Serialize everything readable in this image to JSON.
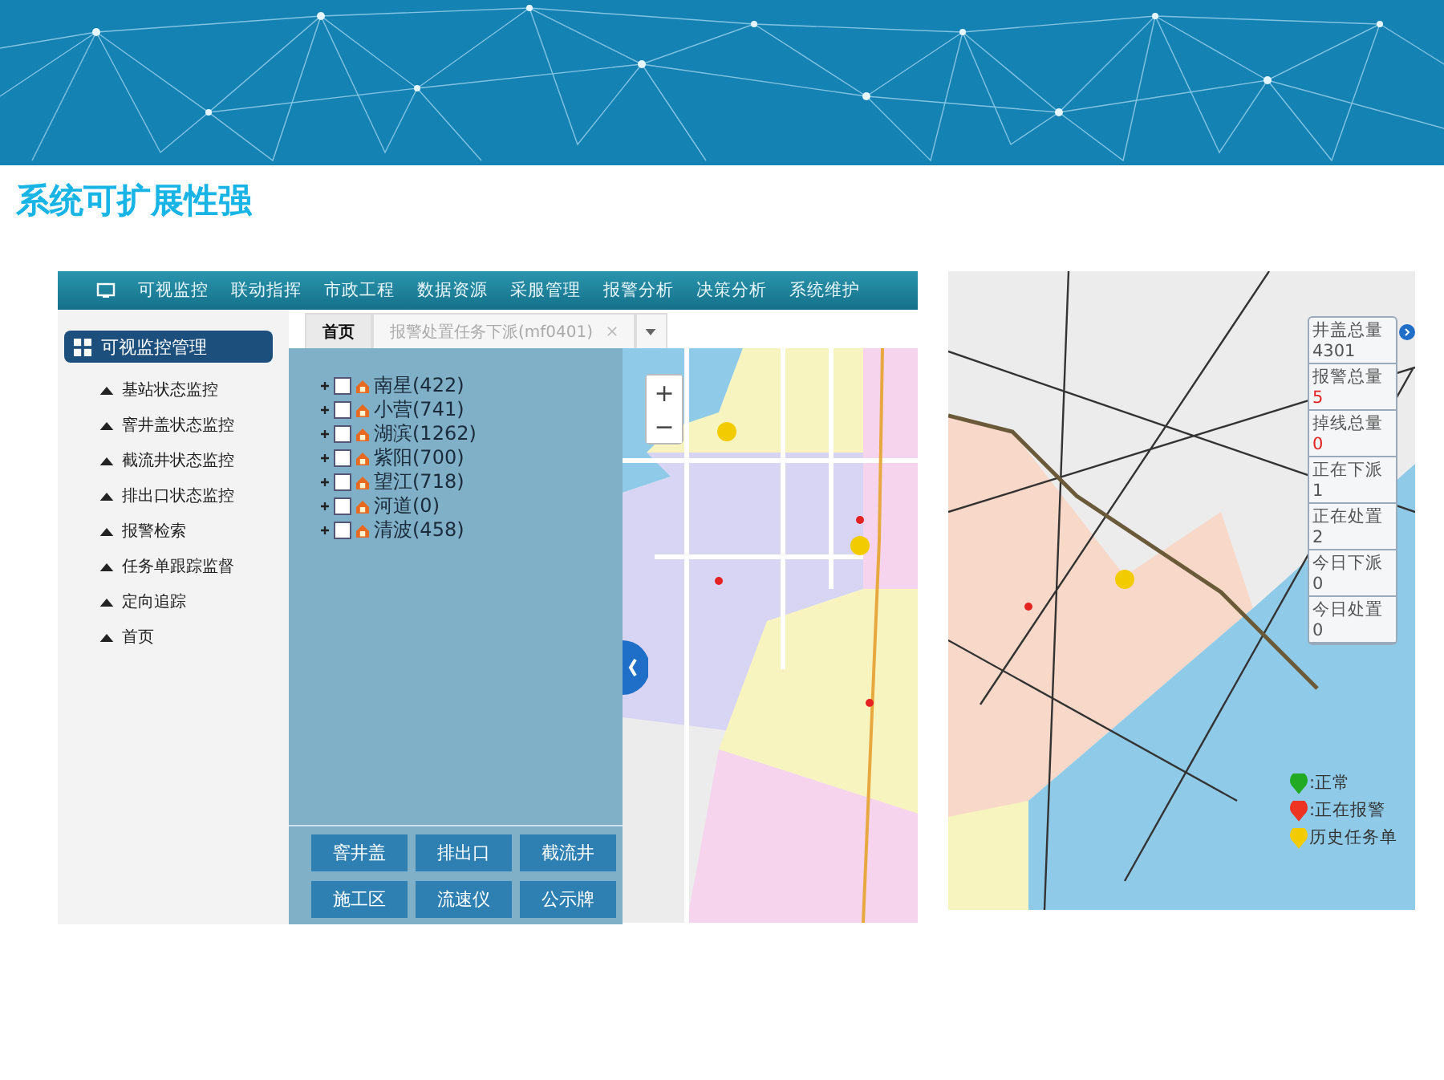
{
  "slide": {
    "title": "系统可扩展性强"
  },
  "left_app": {
    "nav": [
      {
        "label": "可视监控"
      },
      {
        "label": "联动指挥"
      },
      {
        "label": "市政工程"
      },
      {
        "label": "数据资源"
      },
      {
        "label": "采服管理"
      },
      {
        "label": "报警分析"
      },
      {
        "label": "决策分析"
      },
      {
        "label": "系统维护"
      }
    ],
    "sidebar": {
      "header": "可视监控管理",
      "items": [
        {
          "label": "基站状态监控"
        },
        {
          "label": "窨井盖状态监控"
        },
        {
          "label": "截流井状态监控"
        },
        {
          "label": "排出口状态监控"
        },
        {
          "label": "报警检索"
        },
        {
          "label": "任务单跟踪监督"
        },
        {
          "label": "定向追踪"
        },
        {
          "label": "首页"
        }
      ]
    },
    "tabs": [
      {
        "label": "首页",
        "selected": true,
        "closable": false
      },
      {
        "label": "报警处置任务下派(mf0401)",
        "selected": false,
        "closable": true
      }
    ],
    "tree": [
      {
        "label": "南星(422)",
        "checked": false
      },
      {
        "label": "小营(741)",
        "checked": false
      },
      {
        "label": "湖滨(1262)",
        "checked": false
      },
      {
        "label": "紫阳(700)",
        "checked": false
      },
      {
        "label": "望江(718)",
        "checked": false
      },
      {
        "label": "河道(0)",
        "checked": false
      },
      {
        "label": "清波(458)",
        "checked": false
      }
    ],
    "buttons": [
      {
        "label": "窨井盖"
      },
      {
        "label": "排出口"
      },
      {
        "label": "截流井"
      },
      {
        "label": "施工区"
      },
      {
        "label": "流速仪"
      },
      {
        "label": "公示牌"
      }
    ],
    "zoom": {
      "in": "+",
      "out": "−"
    }
  },
  "right_app": {
    "stats": [
      {
        "label": "井盖总量",
        "value": "4301",
        "alert": false
      },
      {
        "label": "报警总量",
        "value": "5",
        "alert": true
      },
      {
        "label": "掉线总量",
        "value": "0",
        "alert": true
      },
      {
        "label": "正在下派",
        "value": "1",
        "alert": false
      },
      {
        "label": "正在处置",
        "value": "2",
        "alert": false
      },
      {
        "label": "今日下派",
        "value": "0",
        "alert": false
      },
      {
        "label": "今日处置",
        "value": "0",
        "alert": false
      }
    ],
    "legend": [
      {
        "label": ":正常",
        "color": "#22aa22"
      },
      {
        "label": ":正在报警",
        "color": "#ee3322"
      },
      {
        "label": "历史任务单",
        "color": "#f2cc00"
      }
    ]
  }
}
